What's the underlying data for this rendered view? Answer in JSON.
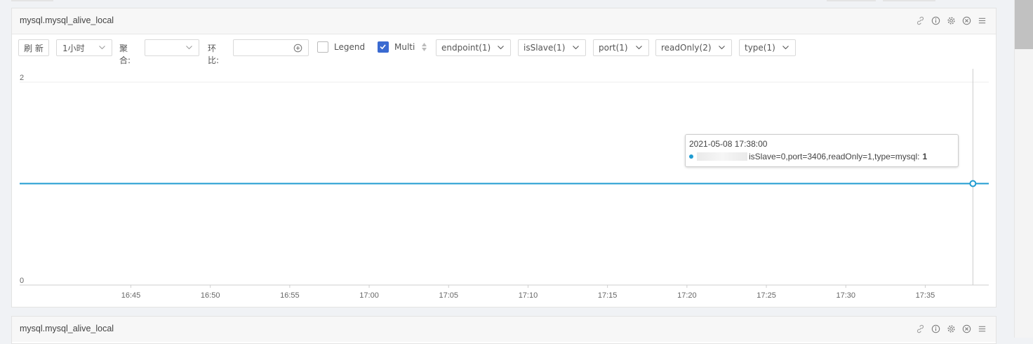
{
  "panels": [
    {
      "title": "mysql.mysql_alive_local",
      "toolbar": {
        "refresh_label": "刷 新",
        "time_range": "1小时",
        "aggregate_label": "聚合:",
        "aggregate_value": "",
        "compare_label": "环比:",
        "compare_value": "",
        "legend_label": "Legend",
        "legend_checked": false,
        "multi_label": "Multi",
        "multi_checked": true,
        "tag_filters": [
          "endpoint(1)",
          "isSlave(1)",
          "port(1)",
          "readOnly(2)",
          "type(1)"
        ]
      },
      "tooltip": {
        "time": "2021-05-08 17:38:00",
        "series_text": "isSlave=0,port=3406,readOnly=1,type=mysql:",
        "value": "1"
      }
    },
    {
      "title": "mysql.mysql_alive_local"
    }
  ],
  "header_icons": [
    "link-icon",
    "info-icon",
    "settings-icon",
    "close-icon",
    "menu-icon"
  ],
  "colors": {
    "series": "#1f9bd1",
    "accent": "#3a6ad1"
  },
  "chart_data": {
    "type": "line",
    "title": "",
    "xlabel": "",
    "ylabel": "",
    "x_ticks": [
      "16:45",
      "16:50",
      "16:55",
      "17:00",
      "17:05",
      "17:10",
      "17:15",
      "17:20",
      "17:25",
      "17:30",
      "17:35"
    ],
    "y_ticks": [
      "0",
      "2"
    ],
    "ylim": [
      0,
      2
    ],
    "x_range": [
      "16:38",
      "17:39"
    ],
    "series": [
      {
        "x": [
          "16:38",
          "17:38",
          "17:39"
        ],
        "values": [
          1,
          1,
          1
        ]
      }
    ],
    "highlight": {
      "x": "17:38",
      "value": 1
    },
    "grid": true,
    "legend": "none"
  }
}
